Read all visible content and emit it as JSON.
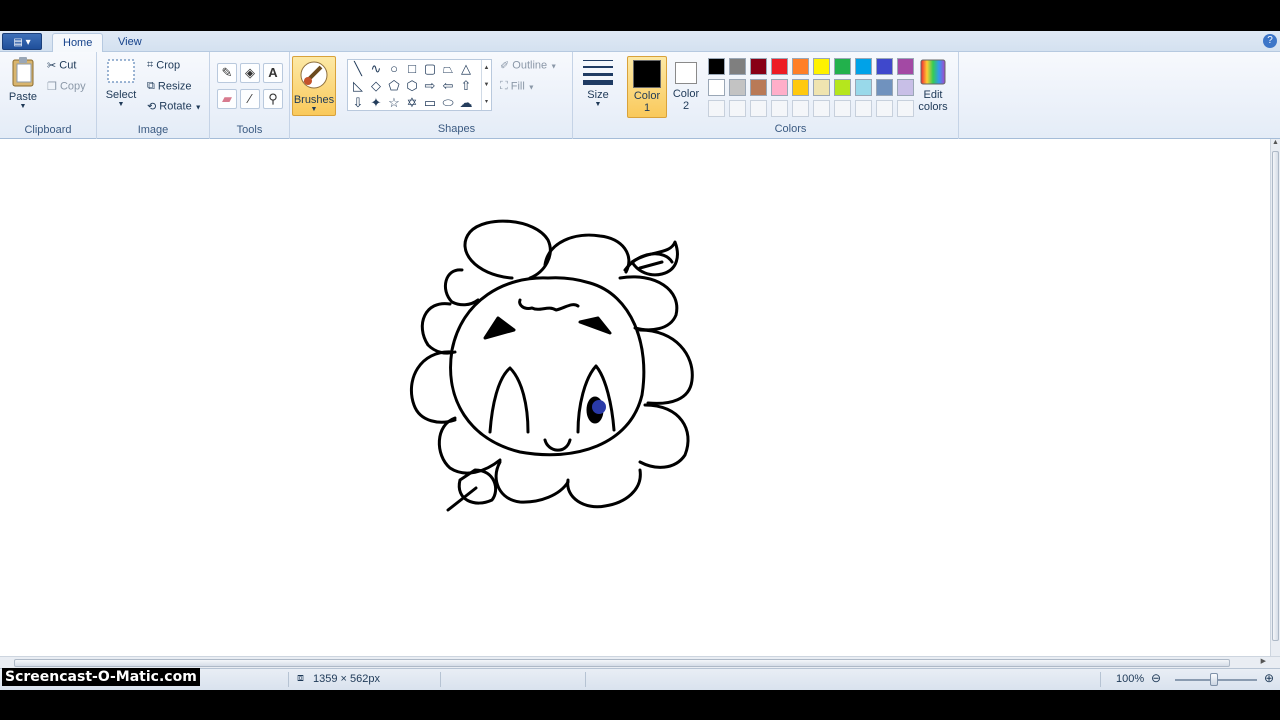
{
  "tabs": {
    "home": "Home",
    "view": "View"
  },
  "help_glyph": "?",
  "clipboard": {
    "group": "Clipboard",
    "paste": "Paste",
    "cut": "Cut",
    "copy": "Copy"
  },
  "image": {
    "group": "Image",
    "select": "Select",
    "crop": "Crop",
    "resize": "Resize",
    "rotate": "Rotate"
  },
  "tools": {
    "group": "Tools"
  },
  "brushes": {
    "label": "Brushes"
  },
  "shapes": {
    "group": "Shapes",
    "outline": "Outline",
    "fill": "Fill"
  },
  "size": {
    "label": "Size"
  },
  "colors": {
    "group": "Colors",
    "color1_line1": "Color",
    "color1_line2": "1",
    "color2_line1": "Color",
    "color2_line2": "2",
    "edit_line1": "Edit",
    "edit_line2": "colors",
    "color1_value": "#000000",
    "color2_value": "#ffffff",
    "palette_row1": [
      "#000000",
      "#7f7f7f",
      "#880015",
      "#ed1c24",
      "#ff7f27",
      "#fff200",
      "#22b14c",
      "#00a2e8",
      "#3f48cc",
      "#a349a4"
    ],
    "palette_row2": [
      "#ffffff",
      "#c3c3c3",
      "#b97a57",
      "#ffaec9",
      "#ffc90e",
      "#efe4b0",
      "#b5e61d",
      "#99d9ea",
      "#7092be",
      "#c8bfe7"
    ]
  },
  "status": {
    "dimensions": "1359 × 562px",
    "zoom": "100%"
  },
  "watermark": "Screencast-O-Matic.com"
}
